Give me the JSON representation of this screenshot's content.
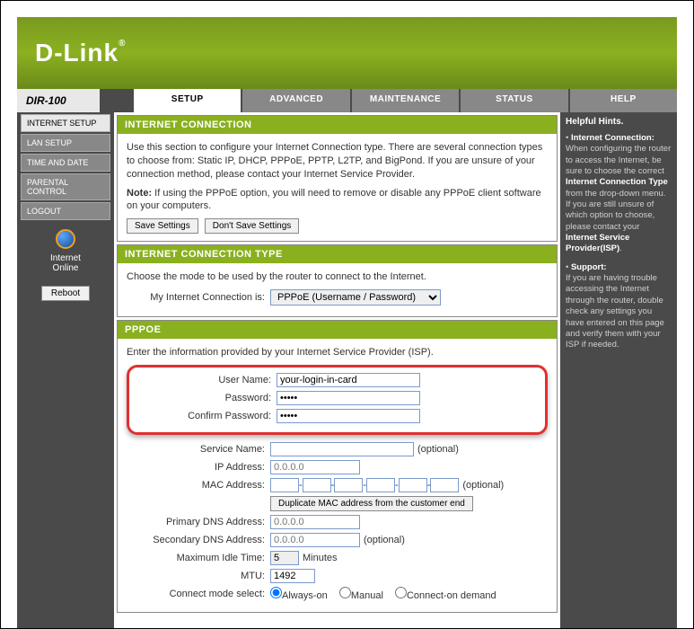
{
  "logo": "D-Link",
  "model": "DIR-100",
  "tabs": [
    "SETUP",
    "ADVANCED",
    "MAINTENANCE",
    "STATUS",
    "HELP"
  ],
  "sidebar": {
    "items": [
      "INTERNET SETUP",
      "LAN SETUP",
      "TIME AND DATE",
      "PARENTAL CONTROL",
      "LOGOUT"
    ],
    "status_line1": "Internet",
    "status_line2": "Online",
    "reboot": "Reboot"
  },
  "panels": {
    "conn": {
      "title": "INTERNET CONNECTION",
      "p1": "Use this section to configure your Internet Connection type. There are several connection types to choose from: Static IP, DHCP, PPPoE, PPTP, L2TP, and BigPond. If you are unsure of your connection method, please contact your Internet Service Provider.",
      "note_label": "Note:",
      "note": " If using the PPPoE option, you will need to remove or disable any PPPoE client software on your computers.",
      "save": "Save Settings",
      "dont": "Don't Save Settings"
    },
    "type": {
      "title": "INTERNET CONNECTION TYPE",
      "desc": "Choose the mode to be used by the router to connect to the Internet.",
      "label": "My Internet Connection is:",
      "value": "PPPoE (Username / Password)"
    },
    "pppoe": {
      "title": "PPPOE",
      "desc": "Enter the information provided by your Internet Service Provider (ISP).",
      "username_label": "User Name:",
      "username": "your-login-in-card",
      "password_label": "Password:",
      "password": "•••••",
      "confirm_label": "Confirm Password:",
      "confirm": "•••••",
      "service_label": "Service Name:",
      "service": "",
      "optional": "(optional)",
      "ip_label": "IP Address:",
      "ip_ph": "0.0.0.0",
      "mac_label": "MAC Address:",
      "mac_btn": "Duplicate MAC address from the customer end",
      "pdns_label": "Primary DNS Address:",
      "sdns_label": "Secondary DNS Address:",
      "idle_label": "Maximum Idle Time:",
      "idle_val": "5",
      "idle_unit": "Minutes",
      "mtu_label": "MTU:",
      "mtu_val": "1492",
      "connect_label": "Connect mode select:",
      "mode1": "Always-on",
      "mode2": "Manual",
      "mode3": "Connect-on demand"
    }
  },
  "hints": {
    "title": "Helpful Hints.",
    "b1": "Internet Connection:",
    "p1a": "When configuring the router to access the Internet, be sure to choose the correct ",
    "b1b": "Internet Connection Type",
    "p1b": " from the drop-down menu. If you are still unsure of which option to choose, please contact your ",
    "b1c": "Internet Service Provider(ISP)",
    "p1c": ".",
    "b2": "Support:",
    "p2": "If you are having trouble accessing the Internet through the router, double check any settings you have entered on this page and verify them with your ISP if needed."
  }
}
